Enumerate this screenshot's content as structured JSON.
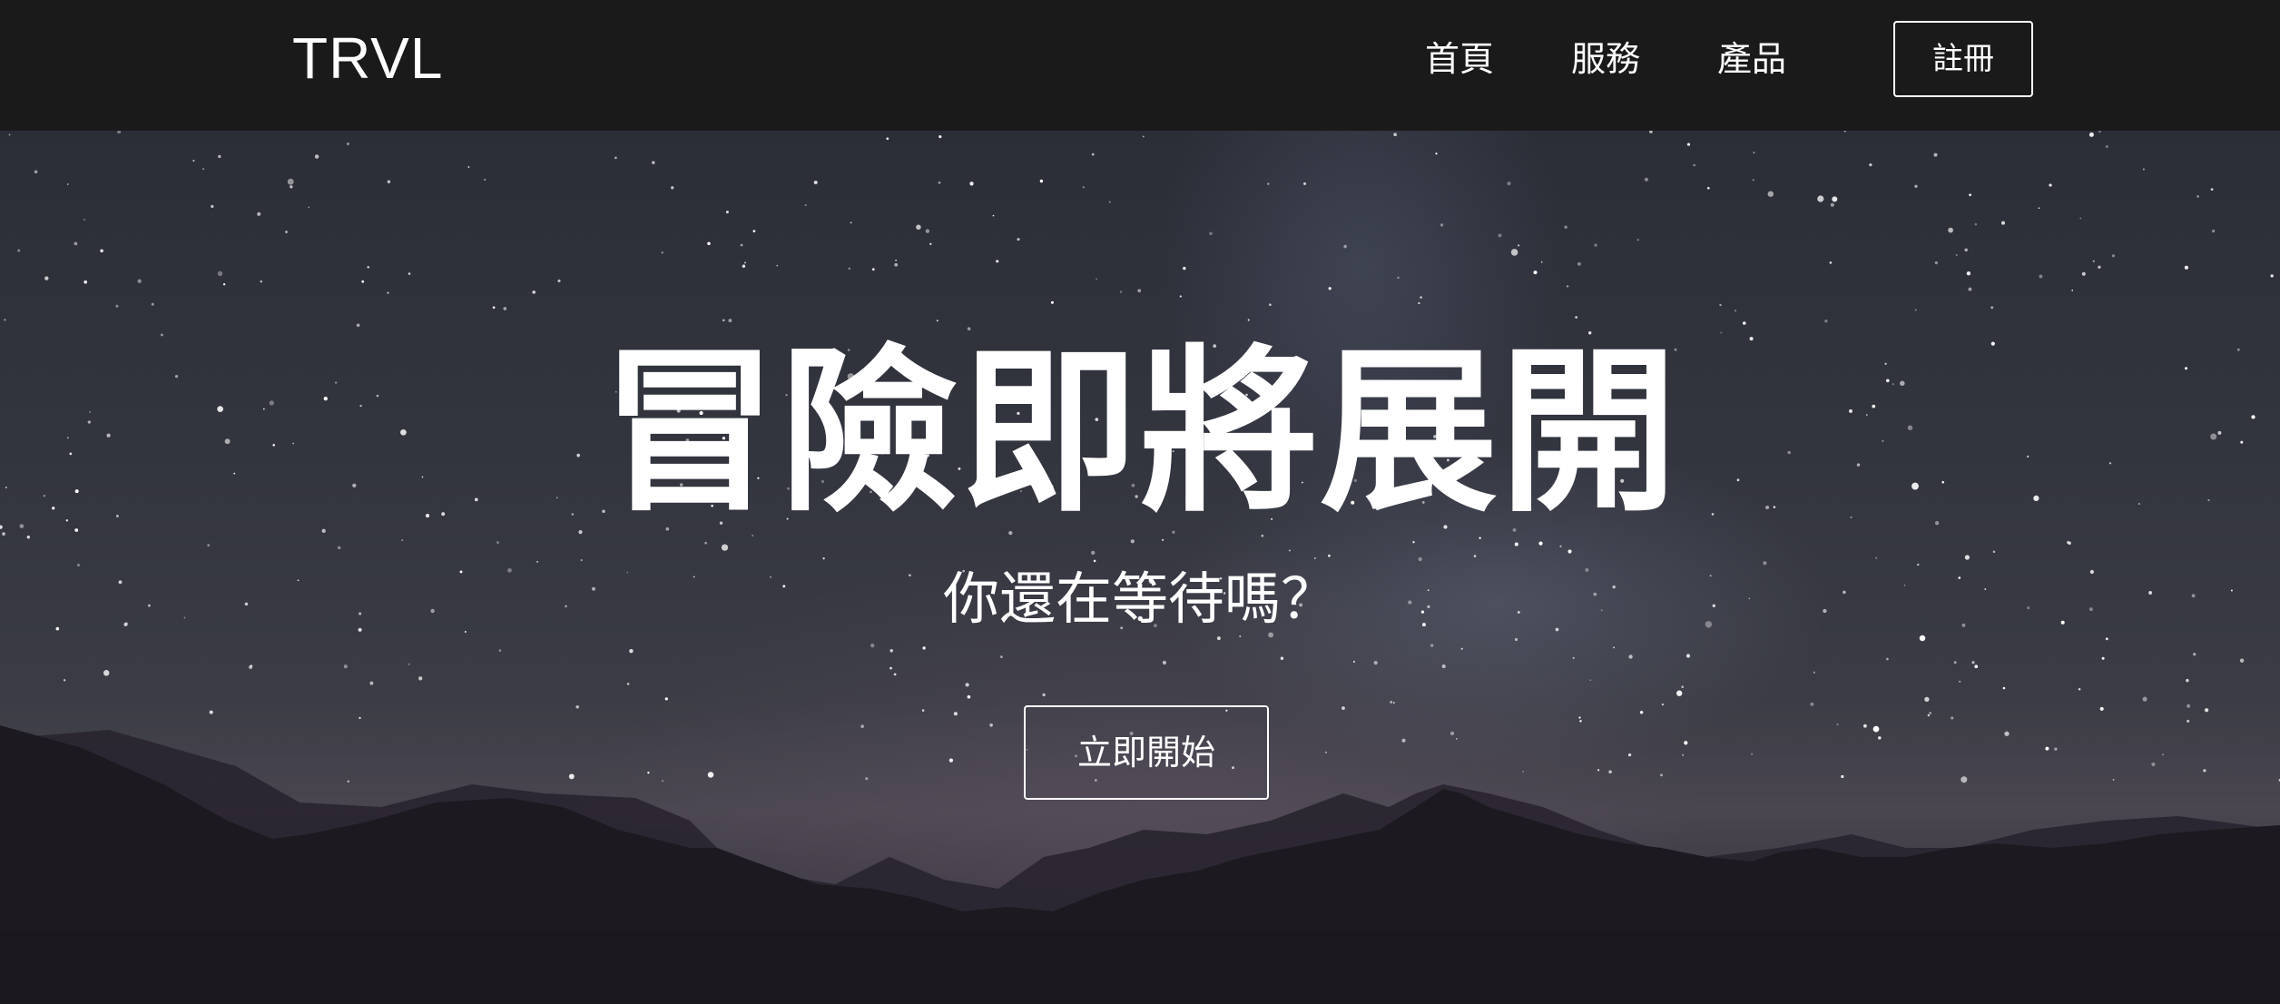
{
  "header": {
    "logo": "TRVL",
    "nav": [
      {
        "label": "首頁"
      },
      {
        "label": "服務"
      },
      {
        "label": "產品"
      }
    ],
    "signup_label": "註冊"
  },
  "hero": {
    "title": "冒險即將展開",
    "subtitle": "你還在等待嗎？",
    "cta_label": "立即開始",
    "background": "night-sky-mountains-image"
  },
  "colors": {
    "navbar_bg": "#1b1a1a",
    "text": "#ffffff",
    "sky": "#33353f",
    "mountains": "#1e1b22"
  }
}
